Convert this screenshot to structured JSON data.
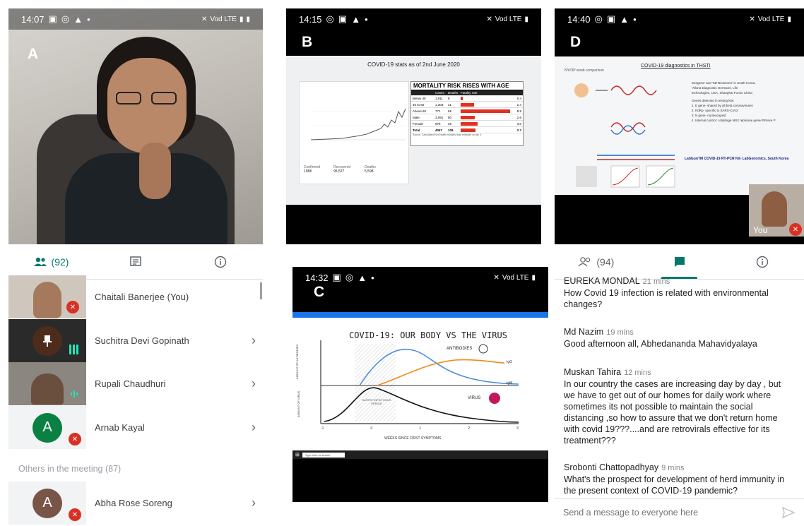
{
  "panel_a": {
    "label": "A",
    "status_time": "14:07",
    "status_right": "Vod LTE",
    "tabs": {
      "people_count": "(92)"
    },
    "participants": [
      {
        "name": "Chaitali Banerjee (You)"
      },
      {
        "name": "Suchitra Devi Gopinath"
      },
      {
        "name": "Rupali Chaudhuri"
      },
      {
        "name": "Arnab Kayal",
        "initial": "A"
      }
    ],
    "others_heading": "Others in the meeting (87)",
    "others": [
      {
        "name": "Abha Rose Soreng",
        "initial": "A"
      }
    ]
  },
  "panel_b": {
    "label": "B",
    "status_time": "14:15",
    "status_right": "Vod LTE",
    "slide_title": "COVID-19 stats as of 2nd June 2020",
    "table_title": "MORTALITY RISK RISES WITH AGE",
    "table_headers": [
      "",
      "Cases",
      "Deaths",
      "Fatality rate"
    ],
    "table_rows": [
      [
        "Below 40",
        "1,911",
        "8",
        "0.4"
      ],
      [
        "40 to 60",
        "1,303",
        "31",
        "2.4"
      ],
      [
        "Above 60",
        "771",
        "69",
        "8.9"
      ],
      [
        "Male",
        "3,091",
        "80",
        "2.6"
      ],
      [
        "Female",
        "976",
        "29",
        "3.0"
      ],
      [
        "Total",
        "4067",
        "109",
        "2.7"
      ]
    ],
    "fatality_values": [
      0.4,
      2.4,
      8.9,
      2.6,
      3.0,
      2.7
    ],
    "table_source": "Source: Calculated from health ministry data released on Apr 4",
    "stats": [
      {
        "label": "Confirmed",
        "value": "198K"
      },
      {
        "label": "Recovered",
        "value": "95,527"
      },
      {
        "label": "Deaths",
        "value": "5,598"
      }
    ]
  },
  "panel_c": {
    "label": "C",
    "status_time": "14:32",
    "status_right": "Vod LTE",
    "slide_title": "COVID-19: OUR BODY VS THE VIRUS",
    "antibodies_label": "ANTIBODIES",
    "virus_label": "VIRUS",
    "x_axis_label": "WEEKS SINCE FIRST SYMPTOMS",
    "y_axis_top": "AMOUNT OF ANTIBODIES",
    "y_axis_bottom": "AMOUNT OF VIRUS",
    "igg": "IgG",
    "igm": "IgM",
    "x_ticks": [
      "-1",
      "0",
      "1",
      "2",
      "3"
    ],
    "window_label": "SAFEST INFECTIOUS PERIOD",
    "taskbar_search": "Type here to search"
  },
  "panel_d": {
    "label": "D",
    "status_time": "14:40",
    "status_right": "Vod LTE",
    "slide_title": "COVID-19 diagnostics in THSTI",
    "slide_subtitle": "NY/OP swab comparison",
    "slide_text": [
      "Seegene' and 'SD Biosensor' in South Korea,",
      "'Allona Diagnostic Germane, Life",
      "technologies, USA, Shanghai Forum China",
      "Genes detected in testing kits:",
      "1.  E gene- shared by all beta coronaviruses",
      "2.  RdRp- specific to SARS-CoV2",
      "3.  N gene- nucleocapsid",
      "4.  Internal control: coliphage MS2 replicase gene/ RNAse P"
    ],
    "slide_footer": "LabGunTM COVID-19 RT-PCR Kit- LabGenomics, South Korea",
    "self_label": "You",
    "tabs": {
      "people_count": "(94)"
    },
    "messages": [
      {
        "author": "EUREKA MONDAL",
        "time": "21 mins",
        "text": "How Covid 19 infection is related with environmental changes?"
      },
      {
        "author": "Md Nazim",
        "time": "19 mins",
        "text": "Good afternoon all, Abhedananda Mahavidyalaya"
      },
      {
        "author": "Muskan Tahira",
        "time": "12 mins",
        "text": "In our country the cases are increasing day by day , but we have to get out of our homes for daily work where sometimes its not possible to maintain the social distancing ,so how to assure that we don't return home with covid 19???....and are retrovirals effective for its treatment???"
      },
      {
        "author": "Srobonti Chattopadhyay",
        "time": "9 mins",
        "text": "What's the prospect for development of herd immunity in the present context of COVID-19 pandemic?"
      }
    ],
    "input_placeholder": "Send a message to everyone here"
  },
  "colors": {
    "accent": "#00796b",
    "mic_off": "#d93025",
    "bar_red": "#e03020"
  }
}
